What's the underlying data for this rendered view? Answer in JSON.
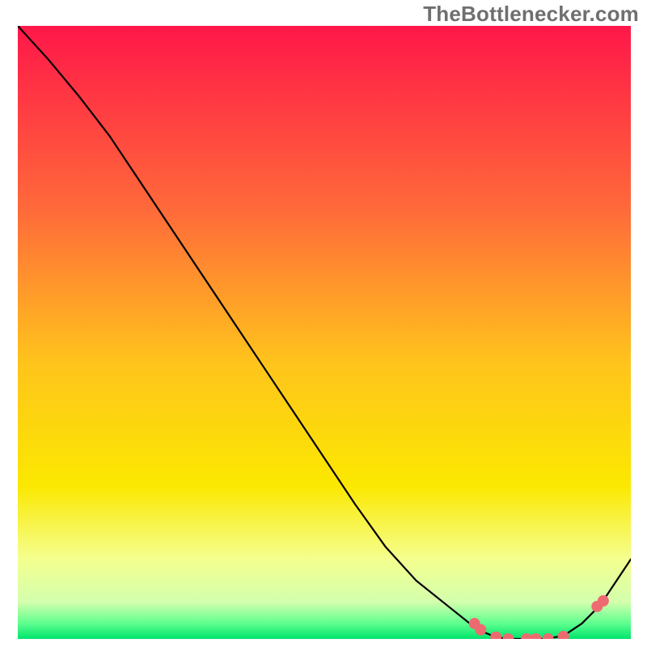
{
  "watermark": "TheBottlenecker.com",
  "chart_data": {
    "type": "line",
    "title": "",
    "xlabel": "",
    "ylabel": "",
    "xlim": [
      0,
      1
    ],
    "ylim": [
      0,
      1
    ],
    "colors": {
      "curve": "#000000",
      "markers": "#ed6b70",
      "gradient_top": "#ff1749",
      "gradient_mid1": "#ff7d34",
      "gradient_mid2": "#fbe800",
      "gradient_band": "#f4ff8f",
      "gradient_bottom_band": "#00e46b"
    },
    "curve": {
      "comment": "approximate y(height share) as a function of x(width share), reading from the plotted black curve; y is the share of the vertical extent measured from the TOP of the plotting area (lower y = higher on screen)",
      "x": [
        0.0,
        0.05,
        0.1,
        0.15,
        0.2,
        0.25,
        0.3,
        0.35,
        0.4,
        0.45,
        0.5,
        0.55,
        0.6,
        0.65,
        0.7,
        0.75,
        0.78,
        0.8,
        0.83,
        0.86,
        0.89,
        0.92,
        0.95,
        1.0
      ],
      "y": [
        0.0,
        0.055,
        0.115,
        0.18,
        0.255,
        0.33,
        0.405,
        0.48,
        0.555,
        0.63,
        0.705,
        0.78,
        0.85,
        0.905,
        0.945,
        0.985,
        0.997,
        1.0,
        1.0,
        1.0,
        0.995,
        0.975,
        0.945,
        0.87
      ]
    },
    "markers": {
      "x": [
        0.745,
        0.755,
        0.78,
        0.8,
        0.83,
        0.845,
        0.865,
        0.89,
        0.945,
        0.955
      ],
      "y": [
        0.975,
        0.985,
        0.997,
        1.0,
        1.0,
        1.0,
        1.0,
        0.996,
        0.947,
        0.938
      ]
    },
    "background_gradient_stops": [
      {
        "offset": 0.0,
        "color": "#ff1749"
      },
      {
        "offset": 0.3,
        "color": "#ff6a3a"
      },
      {
        "offset": 0.55,
        "color": "#ffc41c"
      },
      {
        "offset": 0.75,
        "color": "#fbe800"
      },
      {
        "offset": 0.87,
        "color": "#f4ff8f"
      },
      {
        "offset": 0.94,
        "color": "#d3ffad"
      },
      {
        "offset": 0.975,
        "color": "#5dff8f"
      },
      {
        "offset": 1.0,
        "color": "#00e46b"
      }
    ]
  }
}
